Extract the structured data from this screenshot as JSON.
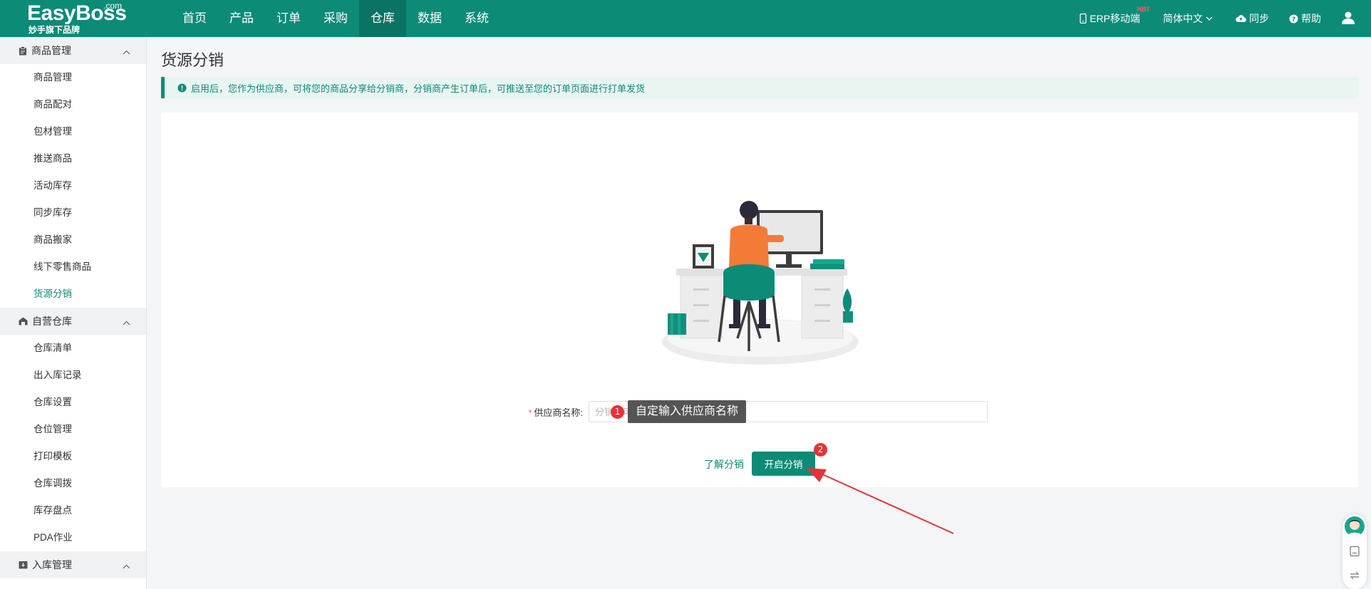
{
  "brand": {
    "name": "EasyBoss",
    "domain_suffix": ".com",
    "tagline": "妙手旗下品牌"
  },
  "nav": {
    "items": [
      {
        "label": "首页"
      },
      {
        "label": "产品"
      },
      {
        "label": "订单"
      },
      {
        "label": "采购"
      },
      {
        "label": "仓库",
        "active": true
      },
      {
        "label": "数据"
      },
      {
        "label": "系统"
      }
    ]
  },
  "header_right": {
    "mobile_label": "ERP移动端",
    "mobile_badge": "HBT",
    "language": "简体中文",
    "sync_label": "同步",
    "help_label": "帮助"
  },
  "sidebar": {
    "groups": [
      {
        "title": "商品管理",
        "icon": "clipboard-icon",
        "items": [
          "商品管理",
          "商品配对",
          "包材管理",
          "推送商品",
          "活动库存",
          "同步库存",
          "商品搬家",
          "线下零售商品",
          "货源分销"
        ]
      },
      {
        "title": "自营仓库",
        "icon": "warehouse-icon",
        "items": [
          "仓库清单",
          "出入库记录",
          "仓库设置",
          "仓位管理",
          "打印模板",
          "仓库调拨",
          "库存盘点",
          "PDA作业"
        ]
      },
      {
        "title": "入库管理",
        "icon": "inbox-icon",
        "items": []
      }
    ],
    "active_item": "货源分销"
  },
  "page": {
    "title": "货源分销",
    "notice": "启用后，您作为供应商，可将您的商品分享给分销商，分销商产生订单后，可推送至您的订单页面进行打单发货",
    "form": {
      "required_mark": "*",
      "supplier_label": "供应商名称:",
      "supplier_placeholder": "分销商可",
      "supplier_value": ""
    },
    "tooltip": "自定输入供应商名称",
    "step1": "1",
    "step2": "2",
    "learn_link": "了解分销",
    "enable_button": "开启分销"
  },
  "colors": {
    "brand": "#0c8b77",
    "brand_dark": "#0a7363",
    "annotation_red": "#e63238",
    "illustration_orange": "#f47a38"
  }
}
